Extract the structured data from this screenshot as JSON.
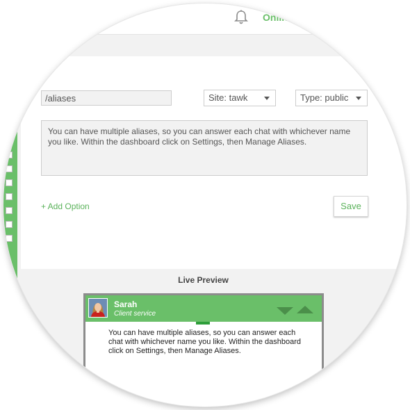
{
  "header": {
    "notification_icon": "bell-icon",
    "status": "Online"
  },
  "form": {
    "alias_value": "/aliases",
    "site_select": "Site: tawk",
    "type_select": "Type: public",
    "message": "You can have multiple aliases, so you can answer each chat with whichever name you like. Within the dashboard click on Settings, then Manage Aliases.",
    "add_option": "+ Add Option",
    "save_label": "Save"
  },
  "preview": {
    "title": "Live Preview",
    "agent_name": "Sarah",
    "agent_role": "Client service",
    "message": "You can have multiple aliases, so you can answer each chat with whichever name you like. Within the dashboard click on Settings, then Manage Aliases."
  },
  "colors": {
    "accent_green": "#6abf69",
    "header_green": "#6abf69",
    "dark_green": "#4b8f4a",
    "background_gray": "#f2f2f2"
  }
}
